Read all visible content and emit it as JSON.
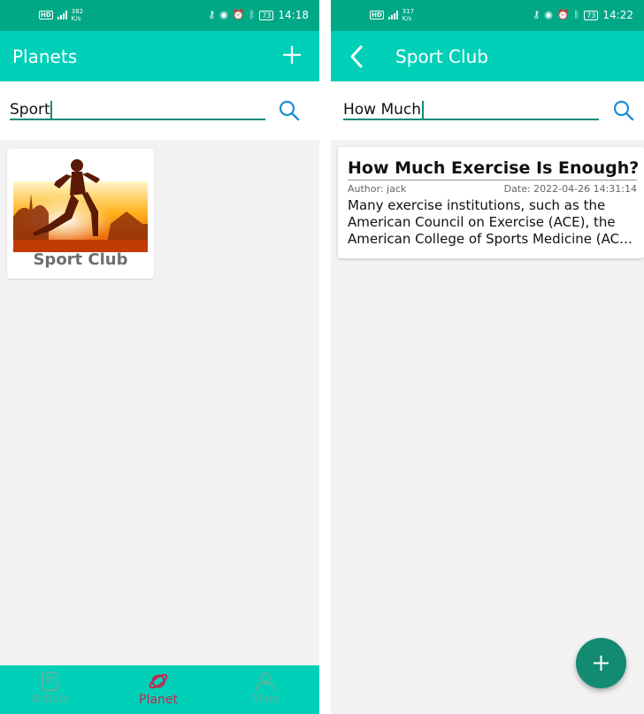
{
  "colors": {
    "status_bar": "#00a886",
    "app_bar": "#00d0b8",
    "accent": "#0e8a7a",
    "fab": "#138a72",
    "nav_active": "#c4264e",
    "nav_inactive": "#5bb3a0",
    "background": "#f2f2f2"
  },
  "left": {
    "status": {
      "net_speed": "382",
      "net_unit": "K/s",
      "battery": "73",
      "time": "14:18"
    },
    "title": "Planets",
    "search": {
      "value": "Sport"
    },
    "planet": {
      "name": "Sport Club"
    },
    "nav": {
      "article": "Article",
      "planet": "Planet",
      "mine": "Mine",
      "active": "planet"
    }
  },
  "right": {
    "status": {
      "net_speed": "317",
      "net_unit": "K/s",
      "battery": "73",
      "time": "14:22"
    },
    "title": "Sport Club",
    "search": {
      "value": "How Much"
    },
    "article": {
      "title": "How Much Exercise Is Enough?",
      "author": "Author: jack",
      "date": "Date: 2022-04-26 14:31:14",
      "excerpt_line1": "Many exercise institutions, such as the",
      "excerpt_line2": "American Council on Exercise (ACE), the",
      "excerpt_line3": "American College of Sports Medicine (AC…"
    }
  }
}
